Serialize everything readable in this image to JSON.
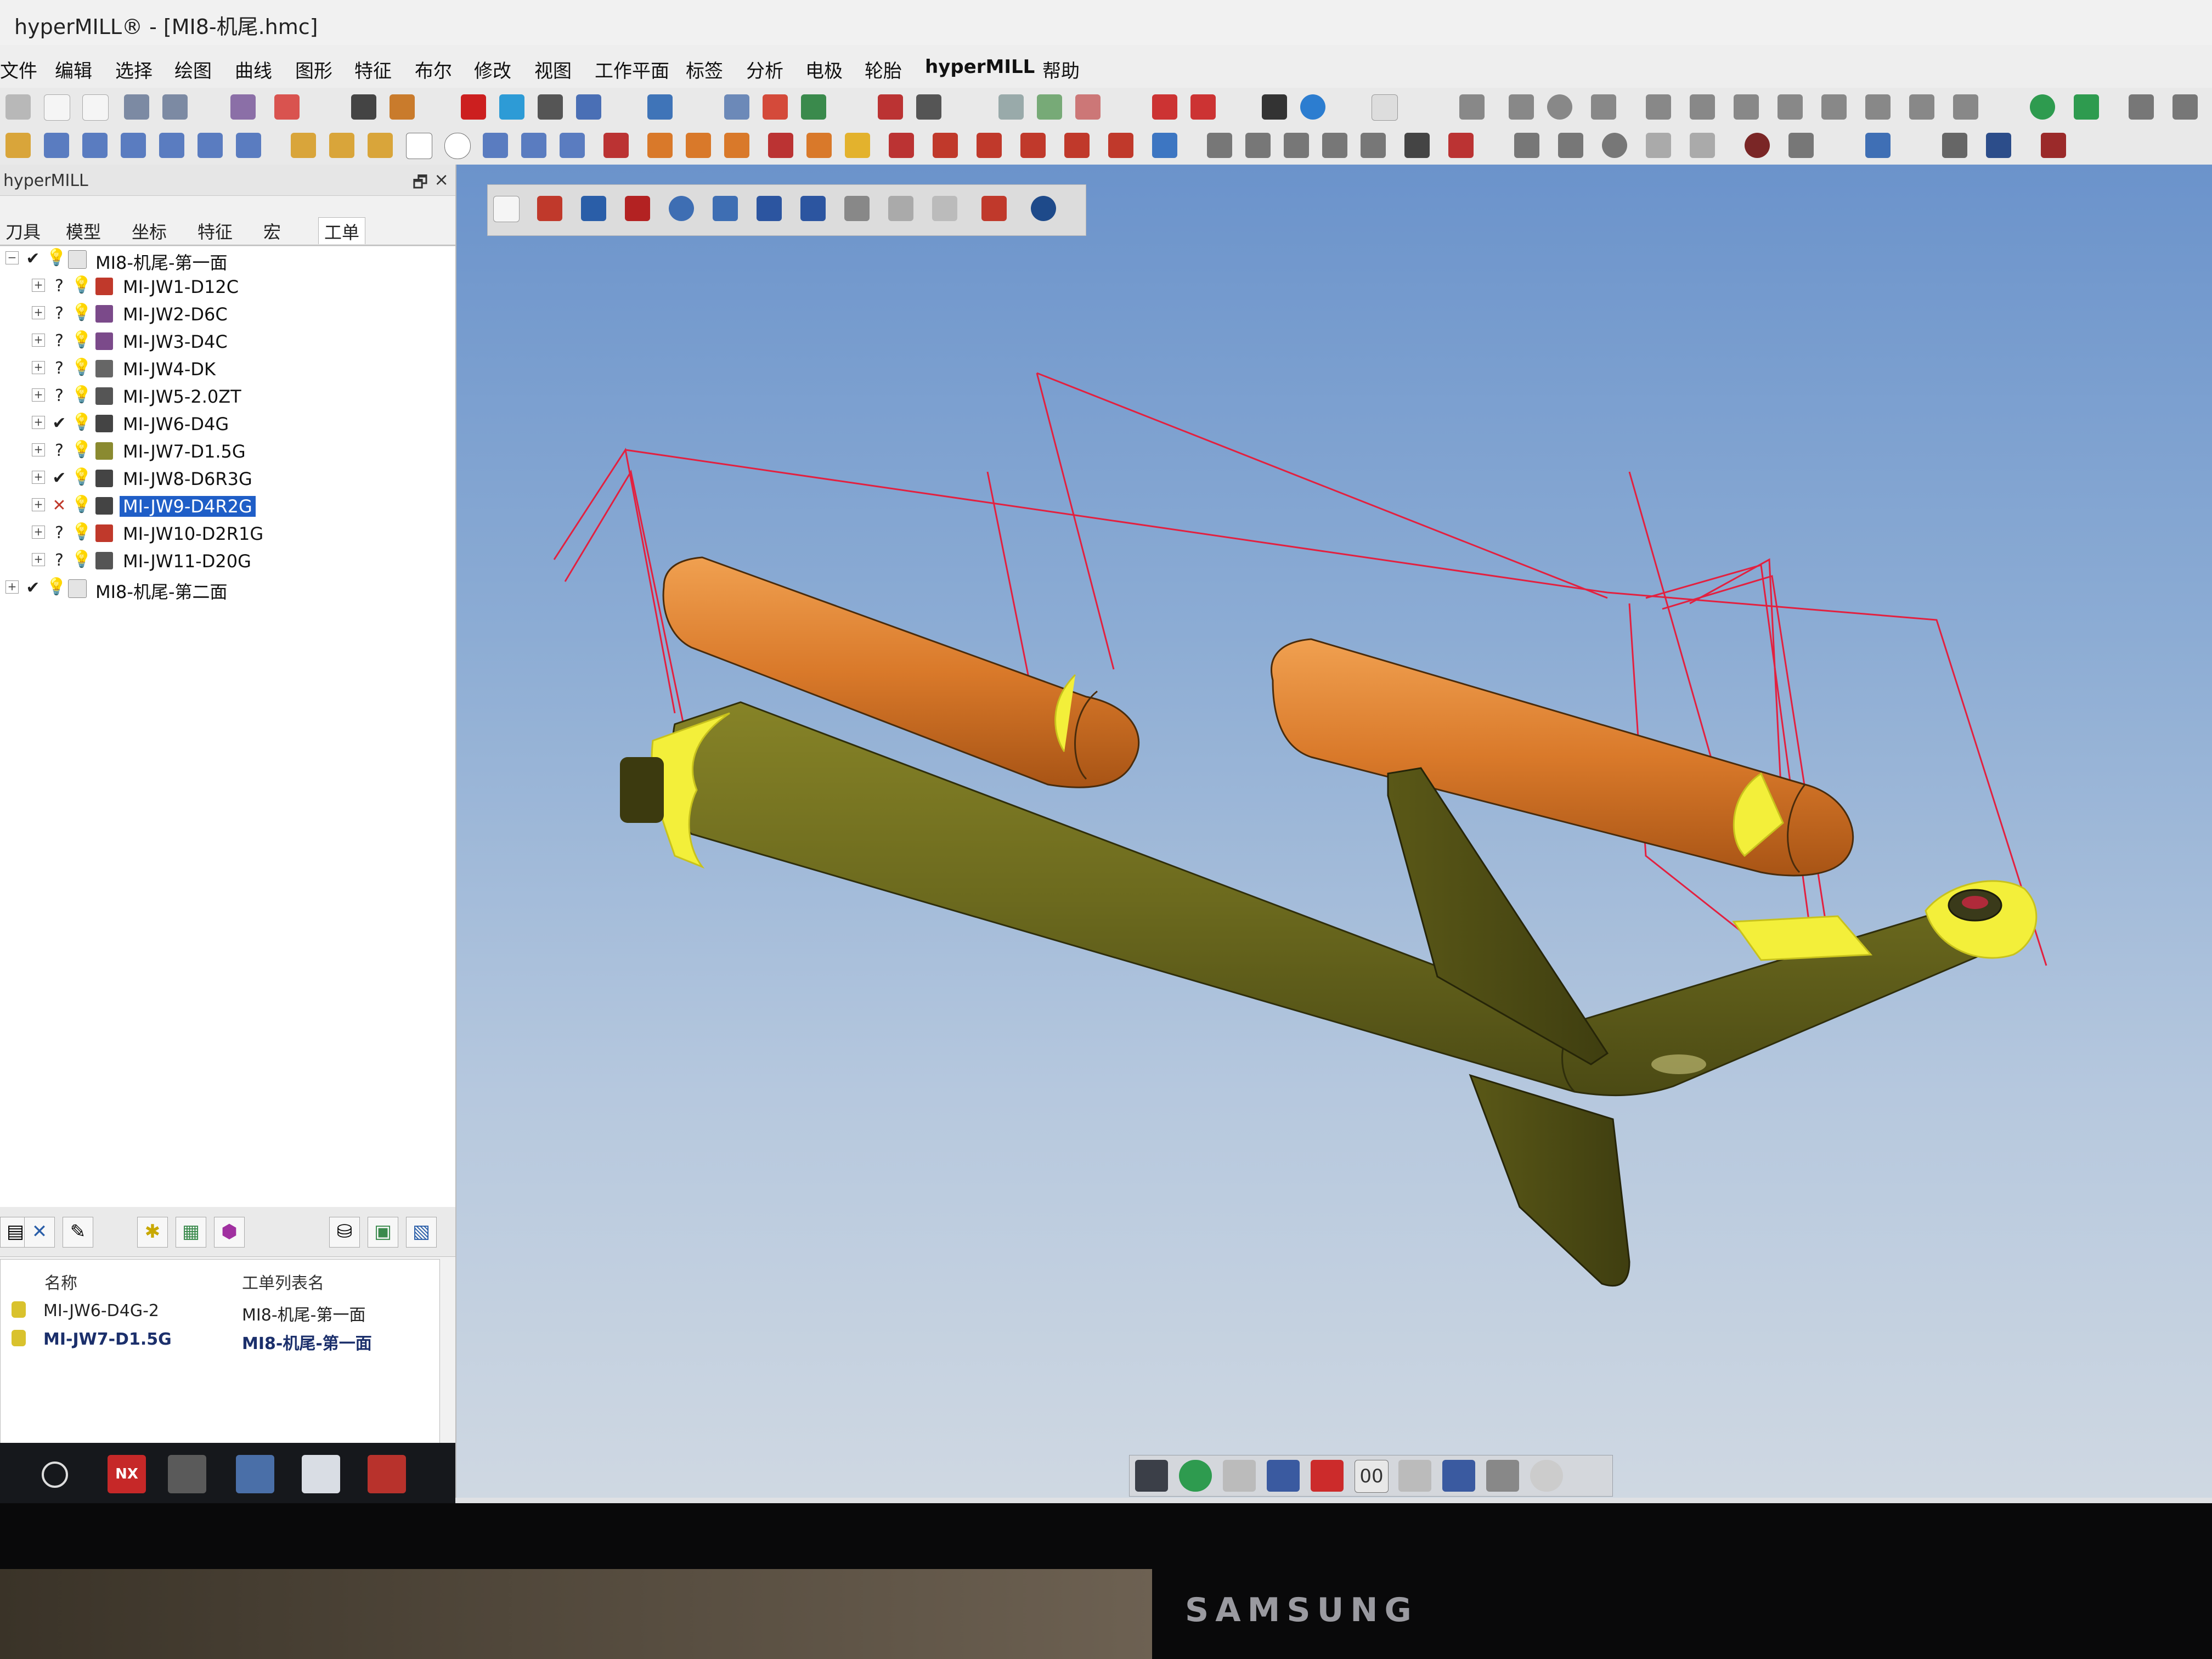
{
  "window": {
    "title": "hyperMILL® - [MI8-机尾.hmc]"
  },
  "menu": [
    "文件",
    "编辑",
    "选择",
    "绘图",
    "曲线",
    "图形",
    "特征",
    "布尔",
    "修改",
    "视图",
    "工作平面",
    "标签",
    "分析",
    "电极",
    "轮胎",
    "hyperMILL",
    "帮助"
  ],
  "panel": {
    "title": "hyperMILL"
  },
  "tabs": [
    "刀具",
    "模型",
    "坐标",
    "特征",
    "宏",
    "工单"
  ],
  "tree": [
    {
      "label": "MI8-机尾-第一面",
      "status": "✔",
      "level": 0,
      "expanded": true
    },
    {
      "label": "MI-JW1-D12C",
      "status": "?",
      "level": 1
    },
    {
      "label": "MI-JW2-D6C",
      "status": "?",
      "level": 1
    },
    {
      "label": "MI-JW3-D4C",
      "status": "?",
      "level": 1
    },
    {
      "label": "MI-JW4-DK",
      "status": "?",
      "level": 1
    },
    {
      "label": "MI-JW5-2.0ZT",
      "status": "?",
      "level": 1
    },
    {
      "label": "MI-JW6-D4G",
      "status": "✔",
      "level": 1
    },
    {
      "label": "MI-JW7-D1.5G",
      "status": "?",
      "level": 1
    },
    {
      "label": "MI-JW8-D6R3G",
      "status": "✔",
      "level": 1
    },
    {
      "label": "MI-JW9-D4R2G",
      "status": "✕",
      "level": 1,
      "selected": true
    },
    {
      "label": "MI-JW10-D2R1G",
      "status": "?",
      "level": 1
    },
    {
      "label": "MI-JW11-D20G",
      "status": "?",
      "level": 1
    },
    {
      "label": "MI8-机尾-第二面",
      "status": "✔",
      "level": 0,
      "expanded": false
    }
  ],
  "joblist": {
    "col_name": "名称",
    "col_list": "工单列表名",
    "rows": [
      {
        "name": "MI-JW6-D4G-2",
        "list": "MI8-机尾-第一面",
        "bold": false
      },
      {
        "name": "MI-JW7-D1.5G",
        "list": "MI8-机尾-第一面",
        "bold": true
      }
    ]
  },
  "viewbar": {
    "label": "00"
  },
  "taskbar": {
    "nx": "NX"
  },
  "monitor": {
    "brand": "SAMSUNG"
  },
  "colors": {
    "selection": "#1f5ec7",
    "body": "#6c6a1e",
    "tank": "#d9792a",
    "highlight": "#f3ef3a",
    "toolpath": "#e3203f"
  }
}
